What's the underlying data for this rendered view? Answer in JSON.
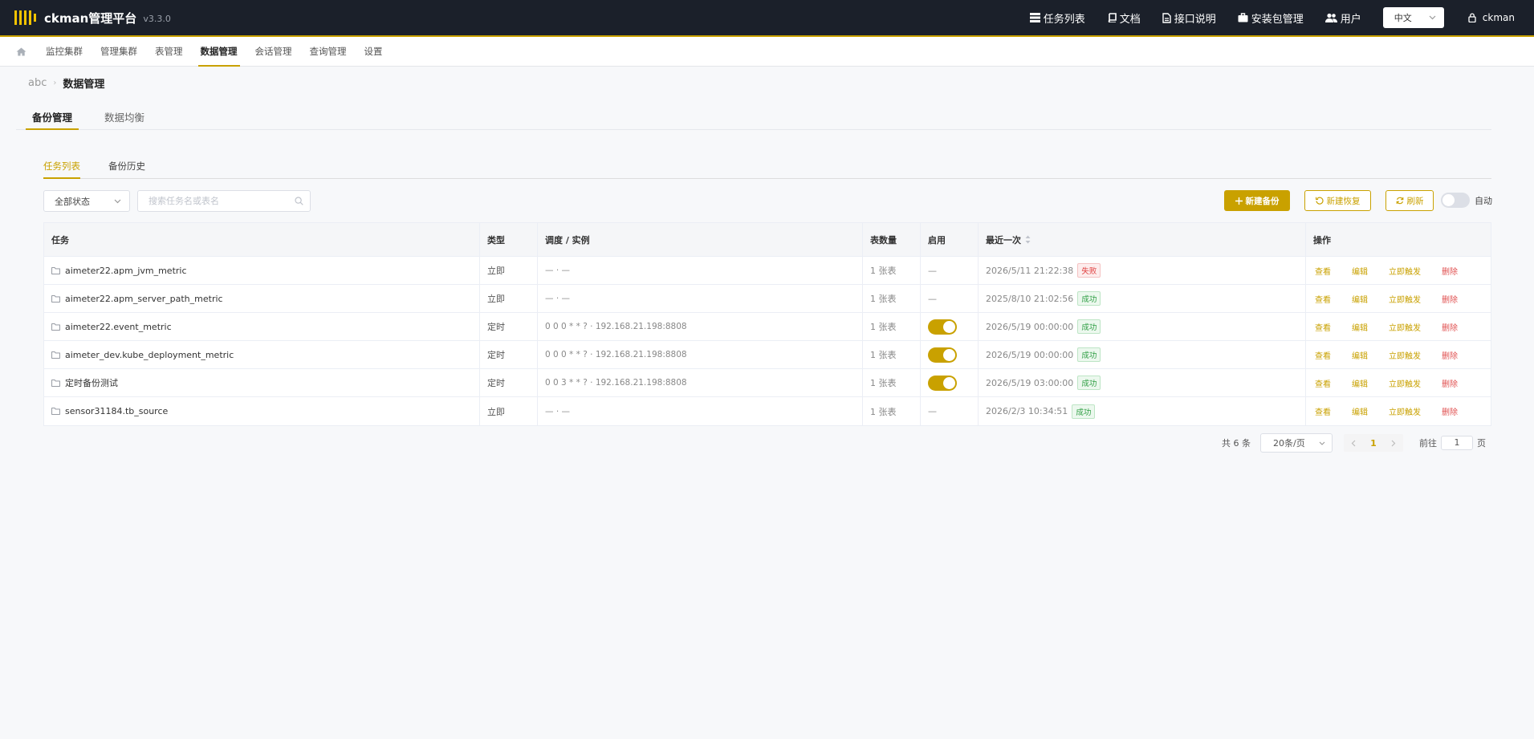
{
  "header": {
    "brand": "ckman管理平台",
    "version": "v3.3.0",
    "nav": [
      {
        "label": "任务列表",
        "icon": "list-icon"
      },
      {
        "label": "文档",
        "icon": "book-icon"
      },
      {
        "label": "接口说明",
        "icon": "file-icon"
      },
      {
        "label": "安装包管理",
        "icon": "briefcase-icon"
      },
      {
        "label": "用户",
        "icon": "users-icon"
      }
    ],
    "language": "中文",
    "username": "ckman"
  },
  "subnav": {
    "items": [
      "监控集群",
      "管理集群",
      "表管理",
      "数据管理",
      "会话管理",
      "查询管理",
      "设置"
    ],
    "active": "数据管理"
  },
  "breadcrumb": {
    "cluster": "abc",
    "page": "数据管理"
  },
  "main_tabs": [
    "备份管理",
    "数据均衡"
  ],
  "inner_tabs": [
    "任务列表",
    "备份历史"
  ],
  "toolbar": {
    "status_filter": "全部状态",
    "search_placeholder": "搜索任务名或表名",
    "new_backup": "新建备份",
    "new_restore": "新建恢复",
    "refresh": "刷新",
    "auto_label": "自动"
  },
  "table": {
    "headers": {
      "task": "任务",
      "type": "类型",
      "schedule": "调度 / 实例",
      "count": "表数量",
      "enabled": "启用",
      "last": "最近一次",
      "ops": "操作"
    },
    "ops_labels": {
      "view": "查看",
      "edit": "编辑",
      "trigger": "立即触发",
      "delete": "删除"
    },
    "rows": [
      {
        "task": "aimeter22.apm_jvm_metric",
        "type": "立即",
        "schedule": "— · —",
        "count": "1 张表",
        "enabled": "—",
        "last": "2026/5/11 21:22:38",
        "status": "失败"
      },
      {
        "task": "aimeter22.apm_server_path_metric",
        "type": "立即",
        "schedule": "— · —",
        "count": "1 张表",
        "enabled": "—",
        "last": "2025/8/10 21:02:56",
        "status": "成功"
      },
      {
        "task": "aimeter22.event_metric",
        "type": "定时",
        "schedule": "0 0 0 * * ? · 192.168.21.198:8808",
        "count": "1 张表",
        "enabled": "on",
        "last": "2026/5/19 00:00:00",
        "status": "成功"
      },
      {
        "task": "aimeter_dev.kube_deployment_metric",
        "type": "定时",
        "schedule": "0 0 0 * * ? · 192.168.21.198:8808",
        "count": "1 张表",
        "enabled": "on",
        "last": "2026/5/19 00:00:00",
        "status": "成功"
      },
      {
        "task": "定时备份测试",
        "type": "定时",
        "schedule": "0 0 3 * * ? · 192.168.21.198:8808",
        "count": "1 张表",
        "enabled": "on",
        "last": "2026/5/19 03:00:00",
        "status": "成功"
      },
      {
        "task": "sensor31184.tb_source",
        "type": "立即",
        "schedule": "— · —",
        "count": "1 张表",
        "enabled": "—",
        "last": "2026/2/3 10:34:51",
        "status": "成功"
      }
    ]
  },
  "pagination": {
    "total": "共 6 条",
    "page_size": "20条/页",
    "current_page": "1",
    "goto_prefix": "前往",
    "goto_value": "1",
    "goto_suffix": "页"
  },
  "colors": {
    "accent": "#c9a100",
    "header_bg": "#1b202a",
    "success": "#2f9e44",
    "fail": "#e04040"
  }
}
